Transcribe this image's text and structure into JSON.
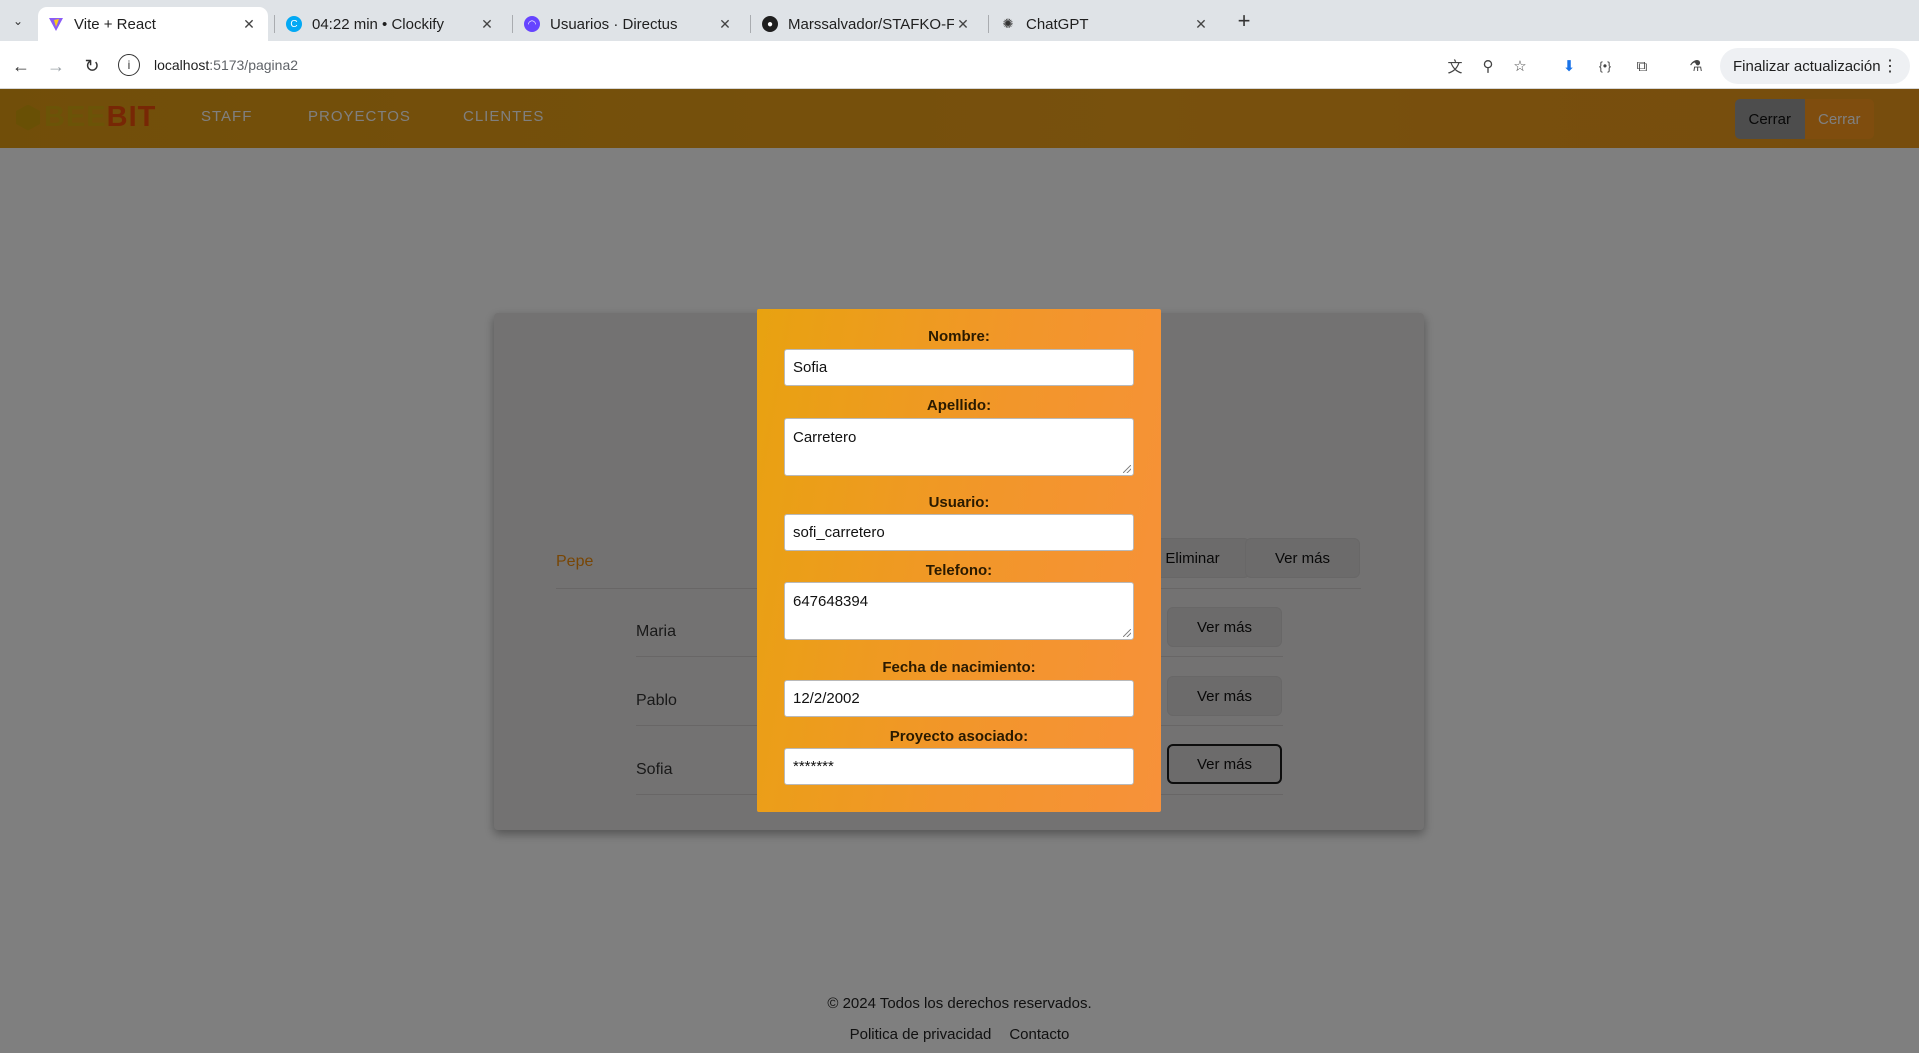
{
  "browser": {
    "tabs": [
      {
        "title": "Vite + React",
        "active": true,
        "icon": "vite-icon"
      },
      {
        "title": "04:22 min • Clockify",
        "active": false,
        "icon": "clockify-icon"
      },
      {
        "title": "Usuarios · Directus",
        "active": false,
        "icon": "directus-icon"
      },
      {
        "title": "Marssalvador/STAFKO-F",
        "active": false,
        "icon": "github-icon"
      },
      {
        "title": "ChatGPT",
        "active": false,
        "icon": "chatgpt-icon"
      }
    ],
    "url_host": "localhost",
    "url_path": ":5173/pagina2",
    "update_label": "Finalizar actualización"
  },
  "app": {
    "logo_part1": "BEE",
    "logo_part2": "BIT",
    "nav": [
      "STAFF",
      "PROYECTOS",
      "CLIENTES"
    ],
    "auth": {
      "left_label": "Cerrar",
      "right_label": "Cerrar"
    },
    "list": [
      {
        "name": "Pepe",
        "actions": [
          "Eliminar",
          "Ver más"
        ]
      },
      {
        "name": "Maria",
        "actions": [
          "Ver más"
        ]
      },
      {
        "name": "Pablo",
        "actions": [
          "Ver más"
        ]
      },
      {
        "name": "Sofia",
        "actions": [
          "Ver más"
        ]
      }
    ],
    "footer": {
      "copyright": "© 2024 Todos los derechos reservados.",
      "links": [
        "Politica de privacidad",
        "Contacto"
      ]
    }
  },
  "modal": {
    "fields": [
      {
        "label": "Nombre:",
        "value": "Sofia"
      },
      {
        "label": "Apellido:",
        "value": "Carretero"
      },
      {
        "label": "Usuario:",
        "value": "sofi_carretero"
      },
      {
        "label": "Telefono:",
        "value": "647648394"
      },
      {
        "label": "Fecha de nacimiento:",
        "value": "12/2/2002"
      },
      {
        "label": "Proyecto asociado:",
        "value": "*******"
      }
    ]
  },
  "colors": {
    "accent_orange": "#ff9b1c",
    "header_gradient_start": "#e39d13",
    "modal_gradient_end": "#f7913a",
    "highlight_name": "#f08c0a"
  }
}
